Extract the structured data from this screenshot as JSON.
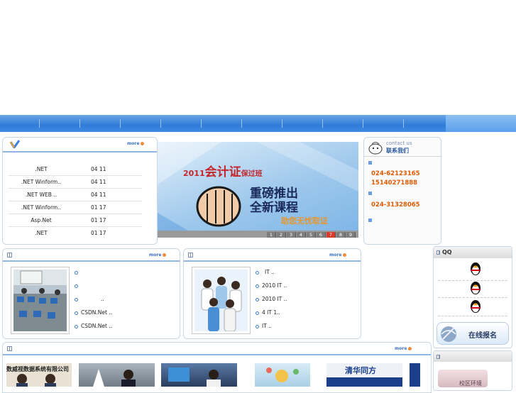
{
  "courses": {
    "more": "more",
    "rows": [
      {
        "title": ".NET",
        "date": "04 11"
      },
      {
        "title": ".NET Winform..",
        "date": "04 11"
      },
      {
        "title": ".NET WEB   ..",
        "date": "04 11"
      },
      {
        "title": ".NET Winform..",
        "date": "01 17"
      },
      {
        "title": "Asp.Net",
        "date": "01 17"
      },
      {
        "title": ".NET",
        "date": "01 17"
      }
    ]
  },
  "banner": {
    "year": "2011",
    "title_big": "会计证",
    "title_small": "保过班",
    "line1": "重磅推出",
    "line2": "全新课程",
    "tagline": "助您无忧取证",
    "pages": [
      "1",
      "2",
      "3",
      "4",
      "5",
      "6",
      "7",
      "8",
      "9"
    ],
    "active_page": "7"
  },
  "contact": {
    "en": "contact us",
    "zh": "联系我们",
    "phone1": "024-62123165",
    "phone2": "15140271888",
    "phone3": "024-31328065"
  },
  "news_left": {
    "more": "more",
    "items": [
      "",
      "",
      "..",
      "CSDN.Net      ..",
      "CSDN.Net      .."
    ]
  },
  "news_right": {
    "more": "more",
    "items": [
      "IT         ..",
      "2010    IT      ..",
      "2010 IT      ..",
      "4    IT      1..",
      "IT          .."
    ]
  },
  "qq": {
    "title": "QQ",
    "signup": "在线报名",
    "campus": "校区环境"
  },
  "gallery": {
    "more": "more",
    "photo1_caption": "数威视数据系统有限公司",
    "photo5_caption": "清华同方"
  },
  "colors": {
    "nav": "#2f7bd8",
    "accent": "#e05a00",
    "link": "#3d6fc0"
  }
}
